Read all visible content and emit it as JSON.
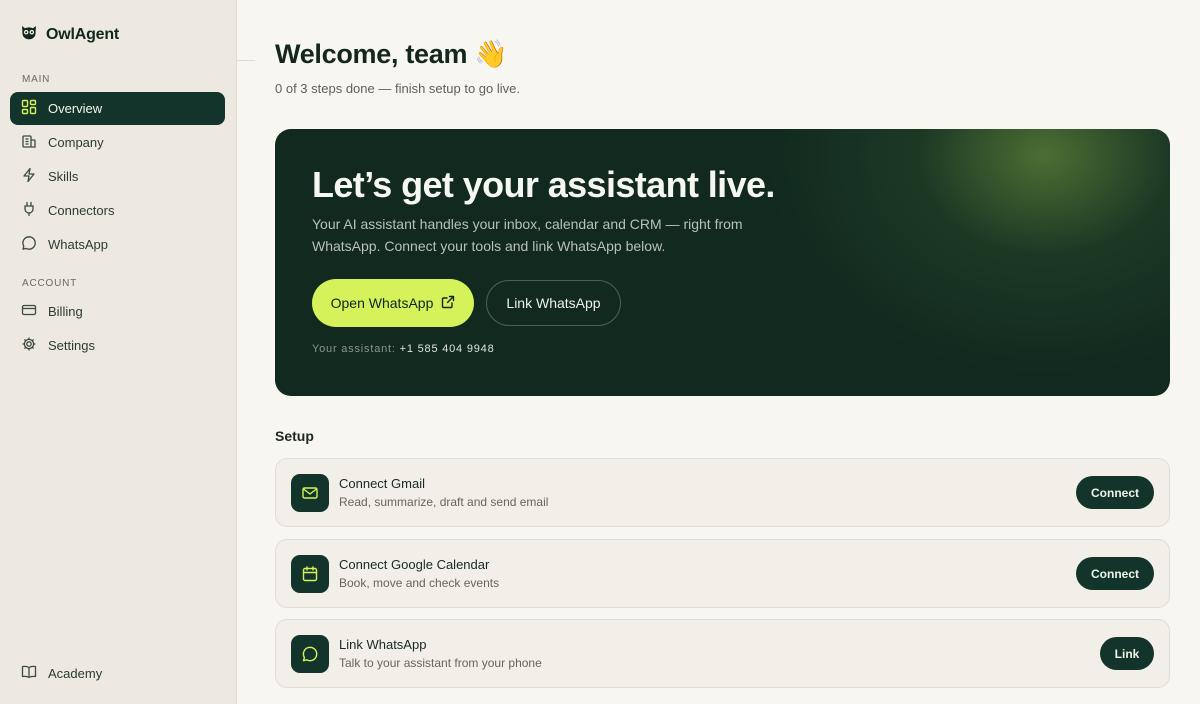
{
  "app": {
    "name": "OwlAgent"
  },
  "sidebar": {
    "main_label": "MAIN",
    "account_label": "ACCOUNT",
    "main_items": [
      {
        "label": "Overview",
        "icon": "layout-grid-icon",
        "active": true
      },
      {
        "label": "Company",
        "icon": "building-icon"
      },
      {
        "label": "Skills",
        "icon": "lightning-icon"
      },
      {
        "label": "Connectors",
        "icon": "plug-icon"
      },
      {
        "label": "WhatsApp",
        "icon": "chat-bubble-icon"
      }
    ],
    "account_items": [
      {
        "label": "Billing",
        "icon": "credit-card-icon"
      },
      {
        "label": "Settings",
        "icon": "gear-icon"
      }
    ],
    "footer_item": {
      "label": "Academy",
      "icon": "book-icon"
    }
  },
  "header": {
    "title": "Welcome, team 👋",
    "subtitle": "0 of 3 steps done — finish setup to go live."
  },
  "hero": {
    "title": "Let’s get your assistant live.",
    "description": "Your AI assistant handles your inbox, calendar and CRM — right from WhatsApp. Connect your tools and link WhatsApp below.",
    "primary_button": "Open WhatsApp",
    "secondary_button": "Link WhatsApp",
    "assistant_label": "Your assistant:",
    "assistant_phone": "+1 585 404 9948"
  },
  "setup": {
    "heading": "Setup",
    "tasks": [
      {
        "title": "Connect Gmail",
        "description": "Read, summarize, draft and send email",
        "button": "Connect",
        "icon": "mail-icon"
      },
      {
        "title": "Connect Google Calendar",
        "description": "Book, move and check events",
        "button": "Connect",
        "icon": "calendar-icon"
      },
      {
        "title": "Link WhatsApp",
        "description": "Talk to your assistant from your phone",
        "button": "Link",
        "icon": "chat-bubble-icon"
      }
    ]
  },
  "colors": {
    "accent": "#d6f25a",
    "dark_green": "#13342a",
    "background": "#f8f6f1",
    "sidebar": "#ede8e0"
  }
}
